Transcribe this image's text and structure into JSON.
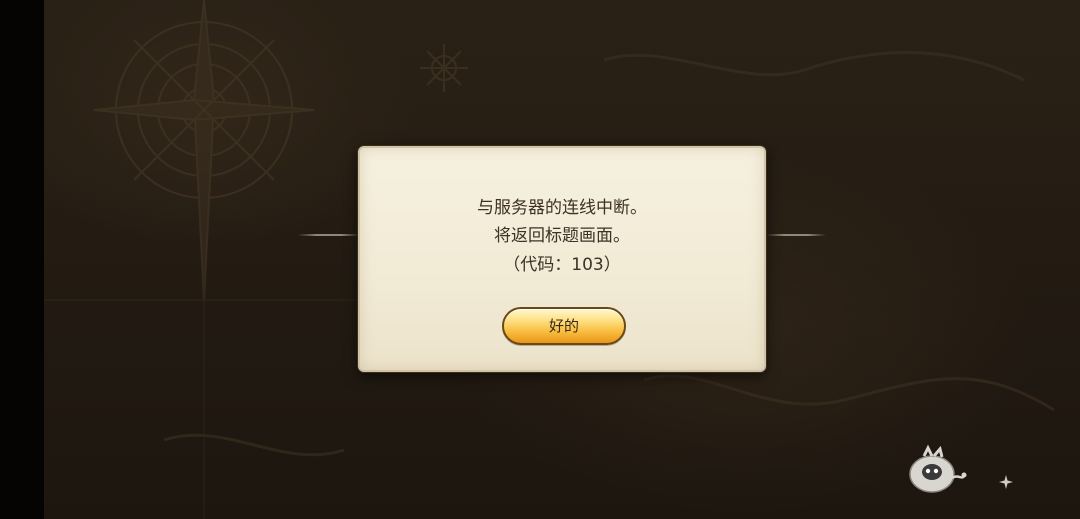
{
  "dialog": {
    "line1": "与服务器的连线中断。",
    "line2": "将返回标题画面。",
    "line3": "（代码：103）",
    "ok_label": "好的"
  },
  "background": {
    "map_icon": "compass-rose-icon",
    "mascot_icon": "mascot-icon",
    "sparkle_icon": "sparkle-icon"
  },
  "colors": {
    "dialog_bg": "#f2ebd6",
    "button_top": "#ffe38a",
    "button_bottom": "#e8961a",
    "text": "#3c3225"
  }
}
